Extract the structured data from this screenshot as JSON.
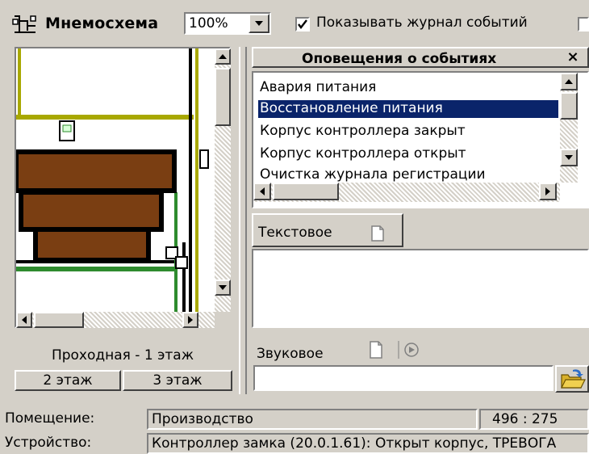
{
  "toolbar": {
    "title": "Мнемосхема",
    "title_icon": "scheme-icon",
    "zoom_value": "100%",
    "show_log_label": "Показывать журнал событий",
    "show_log_checked": true
  },
  "map": {
    "floor_label": "Проходная - 1 этаж",
    "floor_tabs": [
      "2 этаж",
      "3 этаж"
    ]
  },
  "notifications": {
    "title": "Оповещения о событиях",
    "close": "×",
    "events": [
      "Авария питания",
      "Восстановление питания",
      "Корпус контроллера закрыт",
      "Корпус контроллера открыт",
      "Очистка журнала регистрации"
    ],
    "selected_index": 1,
    "text_label": "Текстовое",
    "sound_label": "Звуковое",
    "sound_value": ""
  },
  "status": {
    "room_label": "Помещение:",
    "room_value": "Производство",
    "coords": "496 : 275",
    "device_label": "Устройство:",
    "device_value": "Контроллер замка (20.0.1.61): Открыт корпус, ТРЕВОГА"
  },
  "colors": {
    "window_bg": "#d4d0c8",
    "selection": "#0a246a",
    "room_brown": "#7a3e12",
    "wall_olive": "#a8a800",
    "wall_green": "#2e8b2e"
  }
}
